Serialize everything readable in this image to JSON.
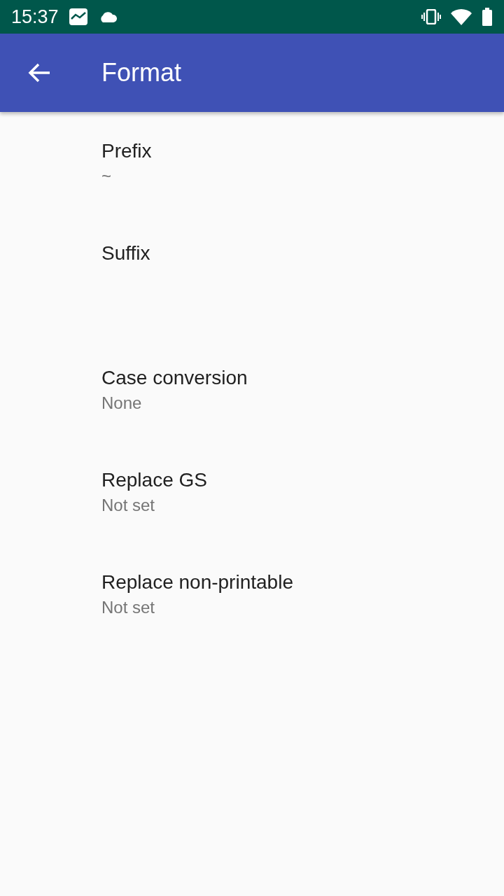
{
  "status_bar": {
    "time": "15:37"
  },
  "app_bar": {
    "title": "Format"
  },
  "preferences": [
    {
      "title": "Prefix",
      "summary": "~"
    },
    {
      "title": "Suffix"
    },
    {
      "title": "Case conversion",
      "summary": "None"
    },
    {
      "title": "Replace GS",
      "summary": "Not set"
    },
    {
      "title": "Replace non-printable",
      "summary": "Not set"
    }
  ]
}
